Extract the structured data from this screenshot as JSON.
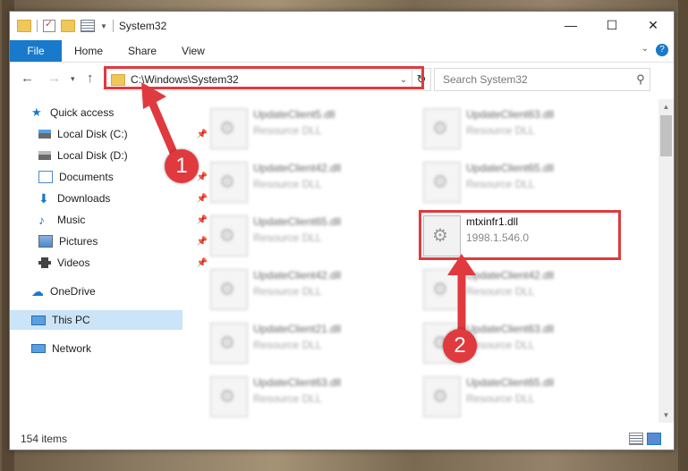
{
  "window": {
    "title": "System32"
  },
  "ribbon": {
    "tabs": [
      "File",
      "Home",
      "Share",
      "View"
    ],
    "help": "?"
  },
  "nav": {
    "address": "C:\\Windows\\System32",
    "search_placeholder": "Search System32"
  },
  "sidebar": {
    "items": [
      {
        "label": "Quick access",
        "icon": "star-icon",
        "pinned": false
      },
      {
        "label": "Local Disk (C:)",
        "icon": "drive-icon",
        "pinned": true
      },
      {
        "label": "Local Disk (D:)",
        "icon": "drive-icon",
        "pinned": false
      },
      {
        "label": "Documents",
        "icon": "documents-icon",
        "pinned": true
      },
      {
        "label": "Downloads",
        "icon": "download-icon",
        "pinned": true
      },
      {
        "label": "Music",
        "icon": "music-icon",
        "pinned": true
      },
      {
        "label": "Pictures",
        "icon": "pictures-icon",
        "pinned": true
      },
      {
        "label": "Videos",
        "icon": "videos-icon",
        "pinned": true
      },
      {
        "label": "OneDrive",
        "icon": "cloud-icon",
        "pinned": false
      },
      {
        "label": "This PC",
        "icon": "computer-icon",
        "pinned": false,
        "selected": true
      },
      {
        "label": "Network",
        "icon": "network-icon",
        "pinned": false
      }
    ]
  },
  "files": {
    "left": [
      {
        "name": "UpdateClient5.dll",
        "sub": "Resource DLL"
      },
      {
        "name": "UpdateClient42.dll",
        "sub": "Resource DLL"
      },
      {
        "name": "UpdateClient65.dll",
        "sub": "Resource DLL"
      },
      {
        "name": "UpdateClient42.dll",
        "sub": "Resource DLL"
      },
      {
        "name": "UpdateClient21.dll",
        "sub": "Resource DLL"
      },
      {
        "name": "UpdateClient63.dll",
        "sub": "Resource DLL"
      }
    ],
    "right": [
      {
        "name": "UpdateClient63.dll",
        "sub": "Resource DLL"
      },
      {
        "name": "UpdateClient65.dll",
        "sub": "Resource DLL"
      },
      {
        "name": "mtxinfr1.dll",
        "sub": "1998.1.546.0"
      },
      {
        "name": "UpdateClient42.dll",
        "sub": "Resource DLL"
      },
      {
        "name": "UpdateClient63.dll",
        "sub": "Resource DLL"
      },
      {
        "name": "UpdateClient65.dll",
        "sub": "Resource DLL"
      }
    ]
  },
  "status": {
    "count": "154 items"
  },
  "callouts": {
    "step1": "1",
    "step2": "2"
  },
  "colors": {
    "accent": "#1979ca",
    "highlight": "#e0393e",
    "selected": "#cce4f7"
  }
}
